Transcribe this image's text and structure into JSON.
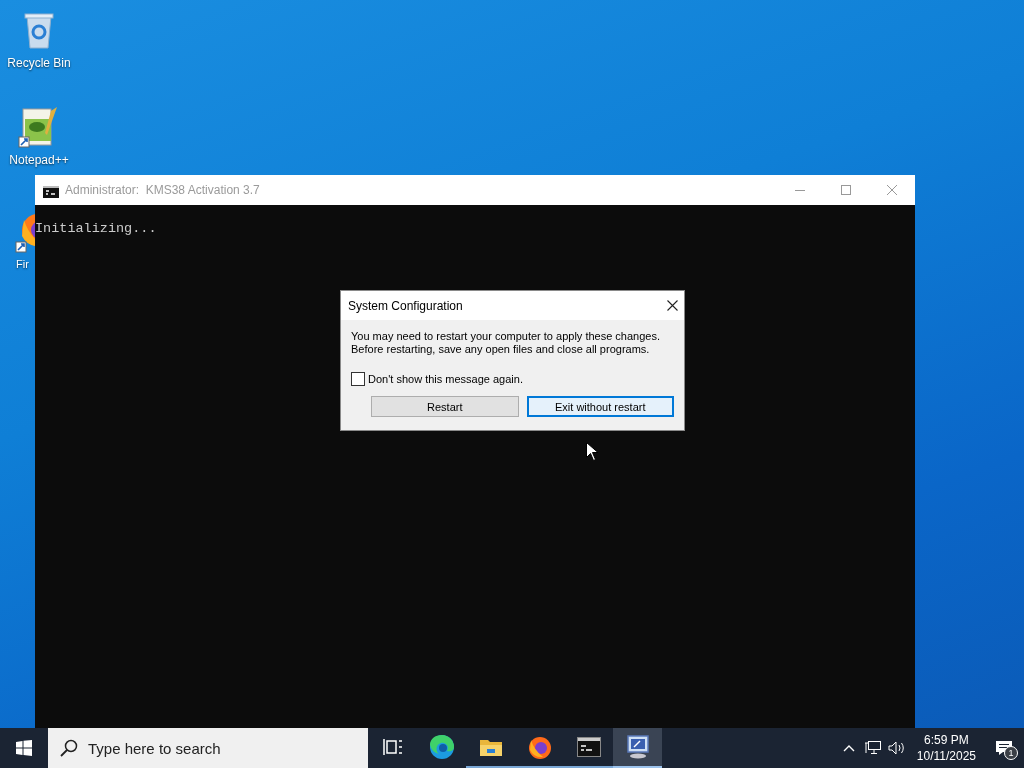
{
  "desktop_icons": [
    {
      "label": "Recycle Bin",
      "kind": "recycle"
    },
    {
      "label": "Notepad++",
      "kind": "notepad"
    },
    {
      "label": "Fir",
      "kind": "firefox"
    }
  ],
  "console": {
    "title": "Administrator:  KMS38 Activation 3.7",
    "output": "Initializing..."
  },
  "dialog": {
    "title": "System Configuration",
    "message_lines": [
      "You may need to restart your computer to apply these changes.",
      "Before restarting, save any open files and close all programs."
    ],
    "checkbox": {
      "label": "Don't show this message again.",
      "checked": false
    },
    "buttons": [
      {
        "label": "Restart",
        "default": false
      },
      {
        "label": "Exit without restart",
        "default": true
      }
    ]
  },
  "taskbar": {
    "search": {
      "placeholder": "Type here to search"
    },
    "apps": [
      {
        "kind": "taskview",
        "running": false,
        "selected": false
      },
      {
        "kind": "edge",
        "running": false,
        "selected": false
      },
      {
        "kind": "explorer",
        "running": true,
        "selected": false
      },
      {
        "kind": "firefox",
        "running": true,
        "selected": false
      },
      {
        "kind": "cmd",
        "running": true,
        "selected": false
      },
      {
        "kind": "msconfig",
        "running": true,
        "selected": true
      }
    ],
    "tray": {
      "time": "6:59 PM",
      "date": "10/11/2025",
      "notifications": "1"
    }
  }
}
